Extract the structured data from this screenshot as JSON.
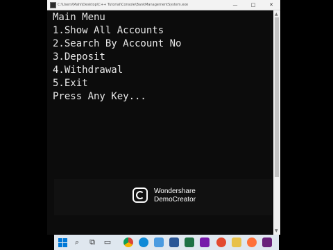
{
  "window": {
    "title": "C:\\Users\\Mahi\\Desktop\\C++ Tutorial\\Console\\BankManagementSystem.exe"
  },
  "console": {
    "lines": [
      "Main Menu",
      "1.Show All Accounts",
      "2.Search By Account No",
      "3.Deposit",
      "4.Withdrawal",
      "5.Exit",
      "Press Any Key..."
    ]
  },
  "watermark": {
    "line1": "Wondershare",
    "line2": "DemoCreator"
  },
  "controls": {
    "minimize": "—",
    "maximize": "□",
    "close": "✕"
  },
  "taskbar": {
    "icons": [
      "windows-start",
      "search",
      "task-view",
      "file-explorer",
      "chrome",
      "edge",
      "store",
      "word",
      "excel",
      "onenote",
      "record",
      "folder",
      "firefox",
      "visual-studio"
    ]
  }
}
